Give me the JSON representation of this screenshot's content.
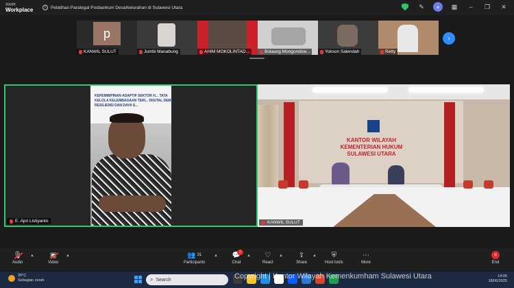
{
  "app": {
    "brand_line1": "zoom",
    "brand_line2": "Workplace",
    "meeting_title": "Pelatihan Paralegal Posbankum Desa/kelurahan di Sulawesi Utara"
  },
  "gallery": {
    "participants": [
      {
        "name": "KANWIL SULUT",
        "initial": "p"
      },
      {
        "name": "Jumbi Manabung"
      },
      {
        "name": "AHIM MOKOLINTAD..."
      },
      {
        "name": "Bolaang Mongondow..."
      },
      {
        "name": "Yokson Salendah"
      },
      {
        "name": "Retty"
      }
    ],
    "next_icon": "chevron-right-icon"
  },
  "main": {
    "left_name": "E. Apri Listiyanto",
    "banner_text": "KEPEMIMPINAN ADAPTIF SEKTOR H... TATA KELOLA KELEMBAGAAN TERI... DIGITAL DEMI RESILIENSI DAN DAYA S...",
    "right_name": "KANWIL SULUT",
    "wall_text": [
      "KANTOR WILAYAH",
      "KEMENTERIAN HUKUM",
      "SULAWESI UTARA"
    ]
  },
  "toolbar": {
    "audio": "Audio",
    "video": "Video",
    "participants": "Participants",
    "participants_count": "31",
    "chat": "Chat",
    "chat_badge": "2",
    "react": "React",
    "share": "Share",
    "host_tools": "Host tools",
    "more": "More",
    "end": "End"
  },
  "taskbar": {
    "temperature": "30°C",
    "weather": "Sebagian cerah",
    "search_placeholder": "Search",
    "time": "14:06",
    "date": "18/06/2025"
  },
  "watermark": "Copyright | Kantor Wilayah Kemenkumham Sulawesi Utara",
  "colors": {
    "active_speaker": "#2ecc71",
    "accent": "#2d8cff",
    "danger": "#e02828"
  }
}
